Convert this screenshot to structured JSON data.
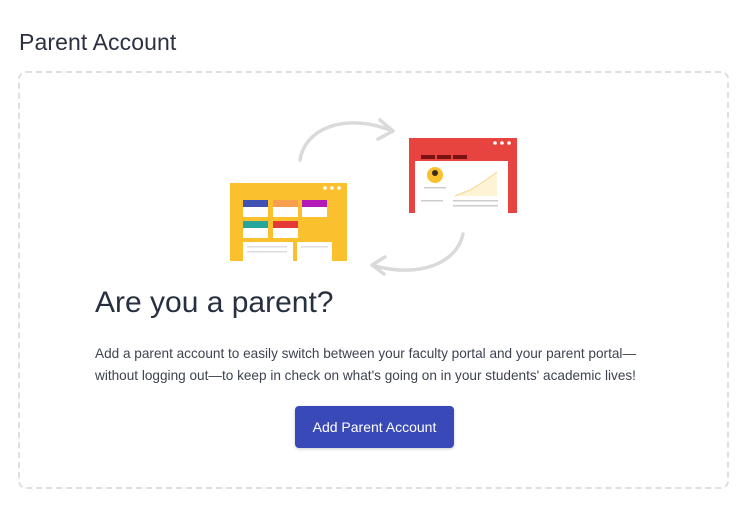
{
  "page": {
    "title": "Parent Account"
  },
  "empty_state": {
    "headline": "Are you a parent?",
    "description": "Add a parent account to easily switch between your faculty portal and your parent portal—without logging out—to keep in check on what's going on in your students' academic lives!",
    "button_label": "Add Parent Account"
  },
  "colors": {
    "accent": "#3a49b8",
    "faculty_portal": "#fbc02d",
    "parent_portal": "#e8443f"
  },
  "illustration": {
    "icons": [
      "faculty-portal-window-icon",
      "parent-portal-window-icon",
      "switch-arrow-icon"
    ]
  }
}
